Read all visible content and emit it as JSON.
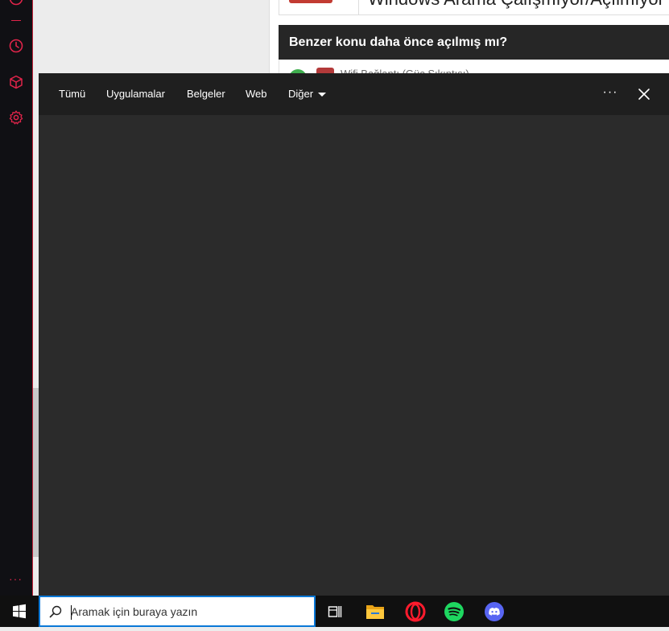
{
  "page_behind": {
    "title_partial": "Windows Arama Çalışmıyor/Açılmıyor",
    "similar_heading": "Benzer konu daha önce açılmış mı?",
    "row_text_partial": "Wifi Bağlantı (Güç Sıkıntısı)"
  },
  "search_flyout": {
    "tabs": [
      {
        "label": "Tümü"
      },
      {
        "label": "Uygulamalar"
      },
      {
        "label": "Belgeler"
      },
      {
        "label": "Web"
      },
      {
        "label": "Diğer"
      }
    ],
    "more_label": "···"
  },
  "taskbar": {
    "search_placeholder": "Aramak için buraya yazın",
    "search_value": ""
  },
  "sidebar": {
    "more_label": "···"
  },
  "colors": {
    "opera_red": "#e0244a",
    "taskbar_bg": "#101010",
    "flyout_bg": "#2b2b2b",
    "flyout_header_bg": "#1f1f1f",
    "search_border": "#0a78d7",
    "spotify_green": "#1ed760",
    "discord_blurple": "#5865f2"
  },
  "icons": {
    "sidebar": [
      "history-icon",
      "cube-icon",
      "settings-gear-icon"
    ],
    "taskbar": [
      "windows-start-icon",
      "search-icon",
      "task-view-icon",
      "file-explorer-icon",
      "opera-icon",
      "spotify-icon",
      "discord-icon"
    ]
  }
}
